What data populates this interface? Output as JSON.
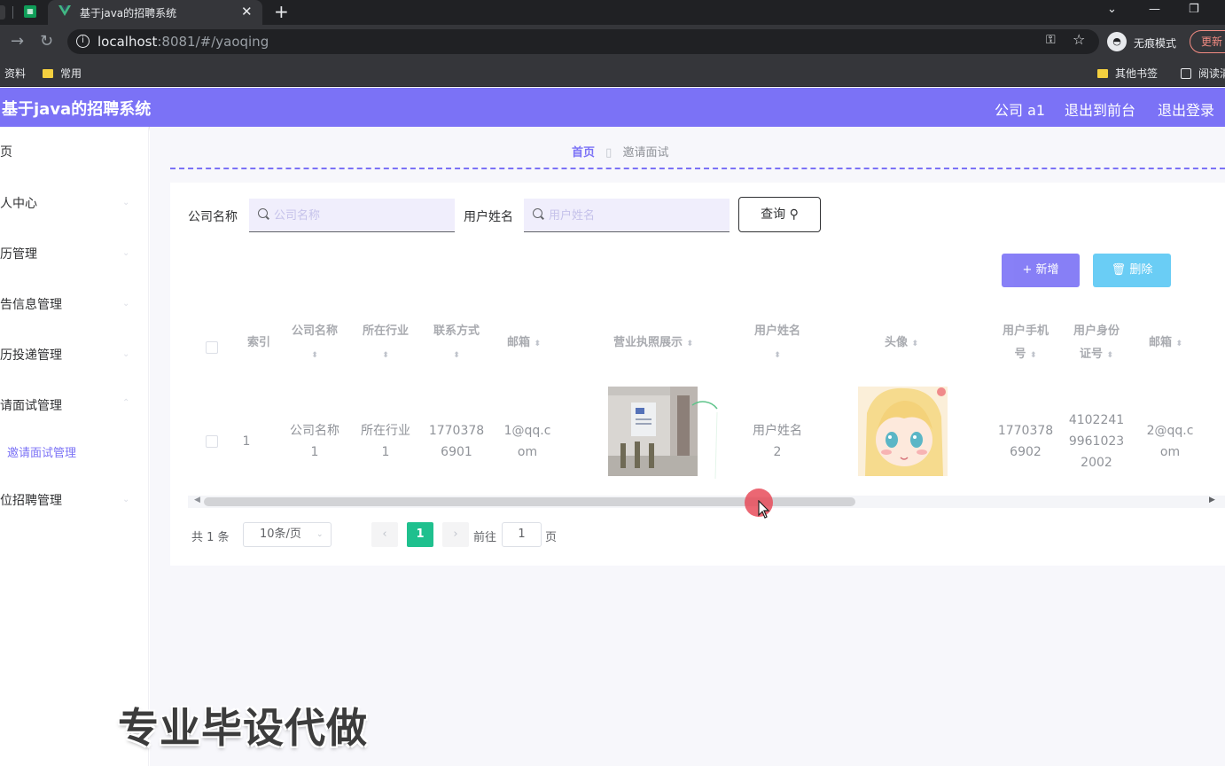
{
  "browser": {
    "tab_title": "基于java的招聘系统",
    "url_host": "localhost",
    "url_rest": ":8081/#/yaoqing",
    "incognito_label": "无痕模式",
    "update_label": "更新",
    "bookmarks": [
      "资料",
      "常用"
    ],
    "bookmarks_right": [
      "其他书签",
      "阅读清"
    ]
  },
  "header": {
    "title": "基于java的招聘系统",
    "company": "公司 a1",
    "exit_front": "退出到前台",
    "logout": "退出登录"
  },
  "sidebar": {
    "items": [
      "页",
      "人中心",
      "历管理",
      "告信息管理",
      "历投递管理",
      "请面试管理",
      "位招聘管理"
    ],
    "sub_item": "邀请面试管理"
  },
  "breadcrumb": {
    "home": "首页",
    "current": "邀请面试"
  },
  "filters": {
    "company_label": "公司名称",
    "company_placeholder": "公司名称",
    "user_label": "用户姓名",
    "user_placeholder": "用户姓名",
    "query_button": "查询"
  },
  "actions": {
    "add": "新增",
    "delete": "删除"
  },
  "table": {
    "headers": {
      "index": "索引",
      "company": "公司名称",
      "industry": "所在行业",
      "contact": "联系方式",
      "email": "邮箱",
      "license": "营业执照展示",
      "username": "用户姓名",
      "avatar": "头像",
      "phone_1": "用户手机",
      "phone_2": "号",
      "idcard_1": "用户身份",
      "idcard_2": "证号",
      "user_email": "邮箱"
    },
    "row": {
      "index": "1",
      "company_1": "公司名称",
      "company_2": "1",
      "industry_1": "所在行业",
      "industry_2": "1",
      "contact_1": "1770378",
      "contact_2": "6901",
      "email_1": "1@qq.c",
      "email_2": "om",
      "username_1": "用户姓名",
      "username_2": "2",
      "phone_1": "1770378",
      "phone_2": "6902",
      "idcard_1": "4102241",
      "idcard_2": "9961023",
      "idcard_3": "2002",
      "user_email_1": "2@qq.c",
      "user_email_2": "om"
    }
  },
  "pagination": {
    "total": "共 1 条",
    "page_size": "10条/页",
    "current_page": "1",
    "goto_label": "前往",
    "goto_value": "1",
    "page_unit": "页"
  },
  "watermark": "专业毕设代做",
  "colors": {
    "accent": "#7b72f6",
    "delete": "#5ac8f5",
    "page_active": "#1fc08e"
  }
}
